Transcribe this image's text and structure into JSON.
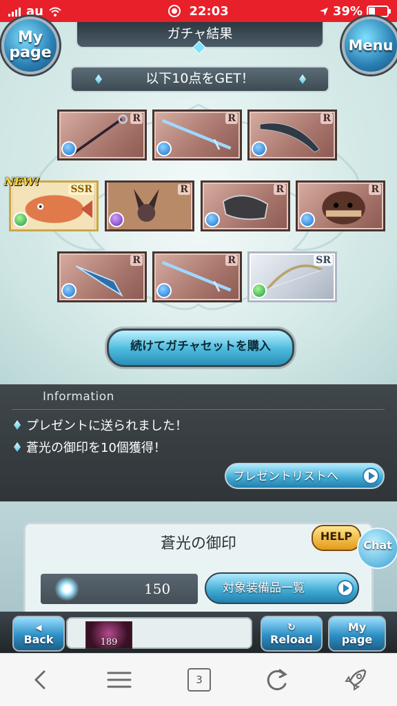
{
  "status_bar": {
    "carrier": "au",
    "time": "22:03",
    "battery": "39%"
  },
  "header": {
    "title": "ガチャ結果",
    "mypage_line1": "My",
    "mypage_line2": "page",
    "menu_label": "Menu"
  },
  "result": {
    "banner": "以下10点をGET！",
    "new_tag": "NEW!"
  },
  "items": [
    {
      "rarity": "R",
      "element": "water"
    },
    {
      "rarity": "R",
      "element": "water"
    },
    {
      "rarity": "R",
      "element": "water"
    },
    {
      "rarity": "SSR",
      "element": "wind"
    },
    {
      "rarity": "R",
      "element": "dark"
    },
    {
      "rarity": "R",
      "element": "water"
    },
    {
      "rarity": "R",
      "element": "water"
    },
    {
      "rarity": "R",
      "element": "water"
    },
    {
      "rarity": "R",
      "element": "water"
    },
    {
      "rarity": "SR",
      "element": "wind"
    }
  ],
  "buy_button": "続けてガチャセットを購入",
  "information": {
    "title": "Information",
    "messages": [
      "プレゼントに送られました！",
      "蒼光の御印を10個獲得！"
    ],
    "present_button": "プレゼントリストへ"
  },
  "seal": {
    "title": "蒼光の御印",
    "count": "150",
    "equipment_button": "対象装備品一覧",
    "help_label": "HELP",
    "chat_label": "Chat"
  },
  "bottom_nav": {
    "back": "Back",
    "reload": "Reload",
    "mypage_line1": "My",
    "mypage_line2": "page",
    "thumb_value": "189"
  },
  "browser": {
    "tabs_count": "3"
  },
  "colors": {
    "status_bar": "#e8202a",
    "accent_blue": "#3ea9d2",
    "info_bg": "#2f3538"
  }
}
